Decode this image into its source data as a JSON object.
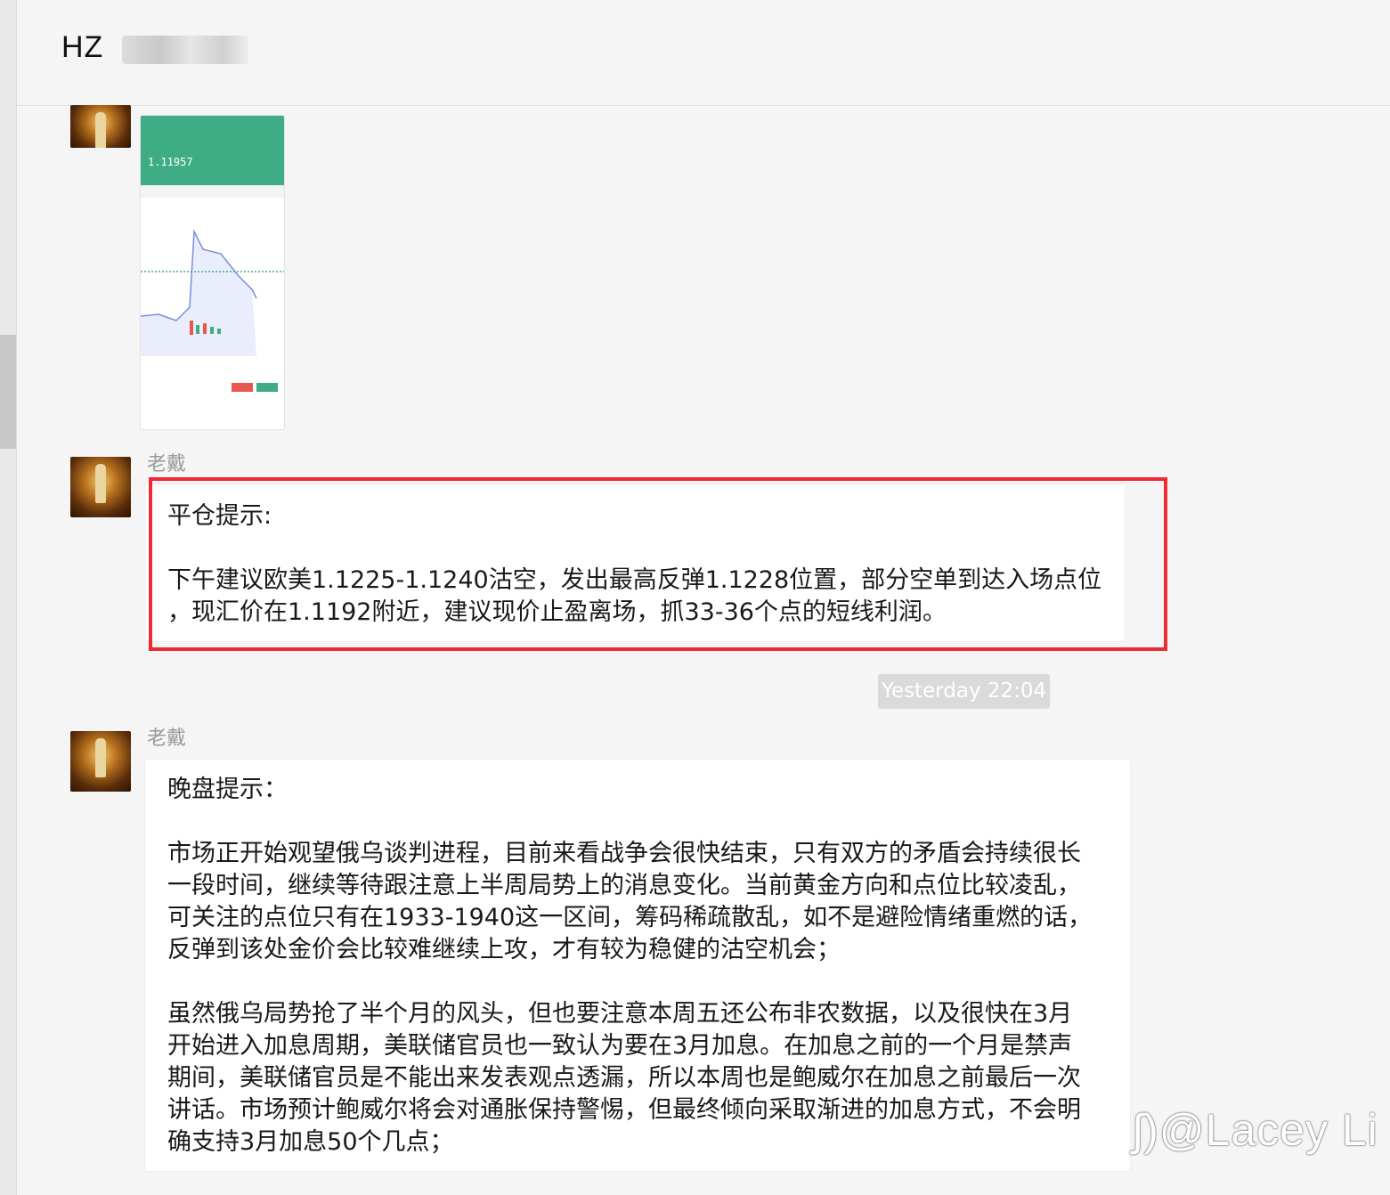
{
  "chat": {
    "title": "HZ"
  },
  "messages": {
    "close_position": {
      "sender": "老戴",
      "heading": "平仓提示:",
      "line1": "下午建议欧美1.1225-1.1240沽空，发出最高反弹1.1228位置，部分空单到达入场点位",
      "line2": "，现汇价在1.1192附近，建议现价止盈离场，抓33-36个点的短线利润。"
    },
    "timestamp": "Yesterday 22:04",
    "evening": {
      "sender": "老戴",
      "heading": "晚盘提示：",
      "para1": [
        "市场正开始观望俄乌谈判进程，目前来看战争会很快结束，只有双方的矛盾会持续很长",
        "一段时间，继续等待跟注意上半周局势上的消息变化。当前黄金方向和点位比较凌乱，",
        "可关注的点位只有在1933-1940这一区间，筹码稀疏散乱，如不是避险情绪重燃的话，",
        "反弹到该处金价会比较难继续上攻，才有较为稳健的沽空机会；"
      ],
      "para2": [
        "虽然俄乌局势抢了半个月的风头，但也要注意本周五还公布非农数据，以及很快在3月",
        "开始进入加息周期，美联储官员也一致认为要在3月加息。在加息之前的一个月是禁声",
        "期间，美联储官员是不能出来发表观点透漏，所以本周也是鲍威尔在加息之前最后一次",
        "讲话。市场预计鲍威尔将会对通胀保持警惕，但最终倾向采取渐进的加息方式，不会明",
        "确支持3月加息50个几点；"
      ]
    },
    "screenshot_thumbnail": {
      "price": "1.11957"
    }
  },
  "watermark": "@Lacey Li",
  "colors": {
    "highlight": "#ee2a34",
    "chart_green": "#3eac85"
  }
}
